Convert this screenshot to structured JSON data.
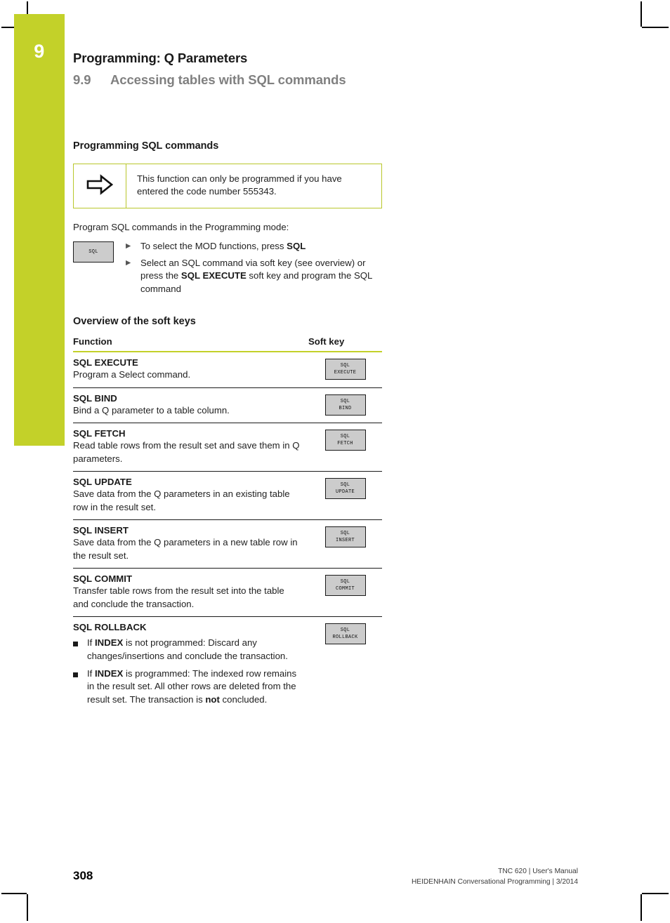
{
  "page": {
    "chapter_number": "9",
    "chapter_title": "Programming: Q Parameters",
    "section_number": "9.9",
    "section_title": "Accessing tables with SQL commands",
    "page_number": "308",
    "accent_color": "#c3d129"
  },
  "programming_section": {
    "heading": "Programming SQL commands",
    "note": {
      "icon": "arrow-right-icon",
      "text": "This function can only be programmed if you have entered the code number 555343."
    },
    "intro": "Program SQL commands in the Programming mode:",
    "key": {
      "line1": "SQL",
      "line2": ""
    },
    "steps": [
      {
        "marker": "▶",
        "text_before": "To select the MOD functions, press ",
        "bold": "SQL",
        "text_after": ""
      },
      {
        "marker": "▶",
        "text_before": "Select an SQL command via soft key (see overview) or press the ",
        "bold": "SQL EXECUTE",
        "text_after": " soft key and program the SQL command"
      }
    ]
  },
  "softkey_table": {
    "heading": "Overview of the soft keys",
    "columns": {
      "function": "Function",
      "softkey": "Soft key"
    },
    "rows": [
      {
        "name": "SQL EXECUTE",
        "description": "Program a Select command.",
        "key_line1": "SQL",
        "key_line2": "EXECUTE"
      },
      {
        "name": "SQL BIND",
        "description": "Bind a Q parameter to a table column.",
        "key_line1": "SQL",
        "key_line2": "BIND"
      },
      {
        "name": "SQL FETCH",
        "description": "Read table rows from the result set and save them in Q parameters.",
        "key_line1": "SQL",
        "key_line2": "FETCH"
      },
      {
        "name": "SQL UPDATE",
        "description": "Save data from the Q parameters in an existing table row in the result set.",
        "key_line1": "SQL",
        "key_line2": "UPDATE"
      },
      {
        "name": "SQL INSERT",
        "description": "Save data from the Q parameters in a new table row in the result set.",
        "key_line1": "SQL",
        "key_line2": "INSERT"
      },
      {
        "name": "SQL COMMIT",
        "description": "Transfer table rows from the result set into the table and conclude the transaction.",
        "key_line1": "SQL",
        "key_line2": "COMMIT"
      }
    ],
    "rollback_row": {
      "name": "SQL ROLLBACK",
      "key_line1": "SQL",
      "key_line2": "ROLLBACK",
      "bullets": [
        {
          "prefix": "If ",
          "bold": "INDEX",
          "suffix": " is not programmed: Discard any changes/insertions and conclude the transaction."
        },
        {
          "prefix": "If ",
          "bold": "INDEX",
          "suffix": " is programmed: The indexed row remains in the result set. All other rows are deleted from the result set. The transaction is ",
          "bold2": "not",
          "suffix2": " concluded."
        }
      ]
    }
  },
  "footer": {
    "line1": "TNC 620 | User's Manual",
    "line2": "HEIDENHAIN Conversational Programming | 3/2014"
  }
}
